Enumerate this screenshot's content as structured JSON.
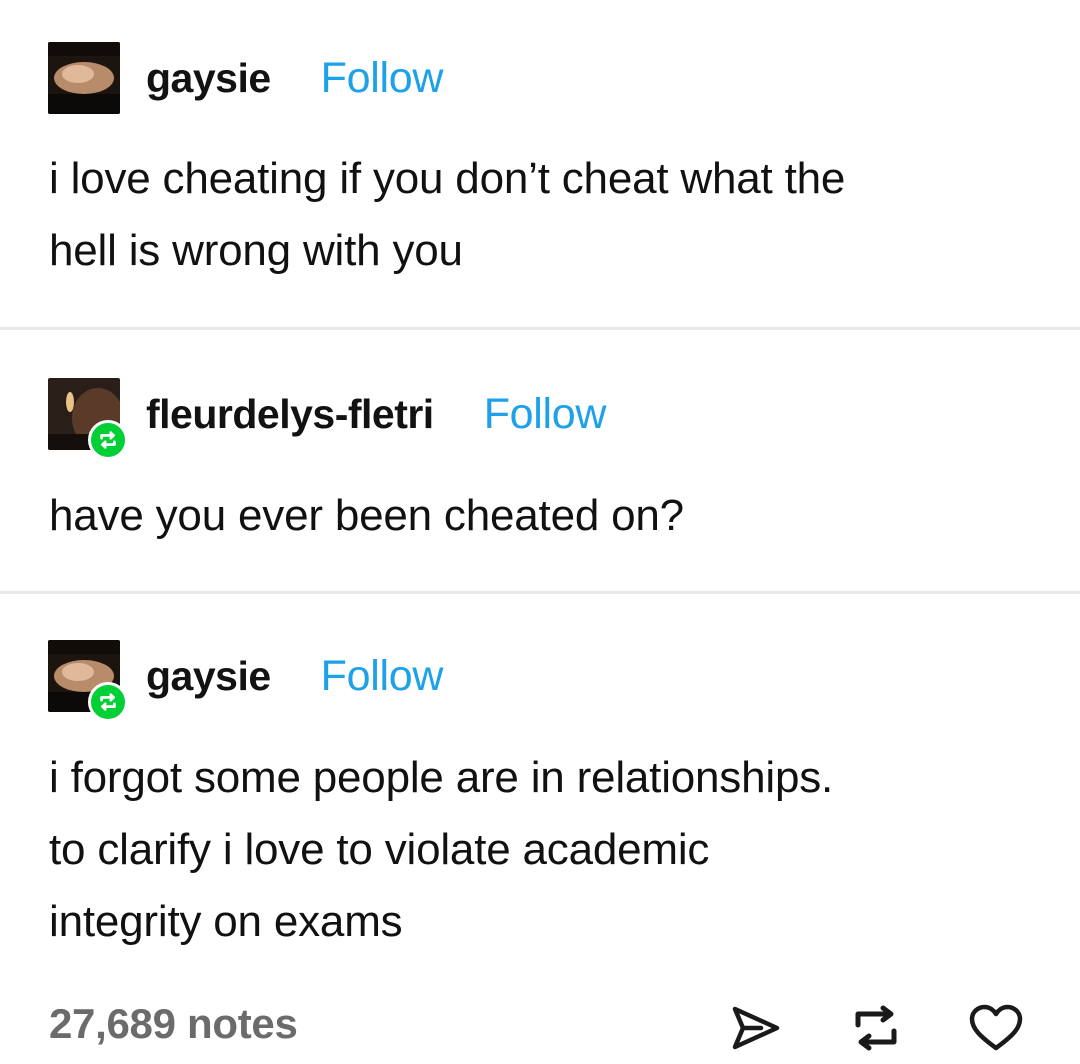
{
  "posts": [
    {
      "username": "gaysie",
      "follow_label": "Follow",
      "reblogged": false,
      "text_lines": [
        "i love cheating if you don’t cheat what the",
        "hell is wrong with you"
      ]
    },
    {
      "username": "fleurdelys-fletri",
      "follow_label": "Follow",
      "reblogged": true,
      "text_lines": [
        "have you ever been cheated on?"
      ]
    },
    {
      "username": "gaysie",
      "follow_label": "Follow",
      "reblogged": true,
      "text_lines": [
        "i forgot some people are in relationships.",
        "to clarify i love to violate academic",
        "integrity on exams"
      ]
    }
  ],
  "footer": {
    "notes_count": "27,689 notes",
    "actions": [
      "share-icon",
      "reblog-icon",
      "like-icon"
    ]
  },
  "colors": {
    "follow": "#1da1e8",
    "reblog_badge": "#00cf35",
    "notes_text": "#6b6b6b"
  }
}
